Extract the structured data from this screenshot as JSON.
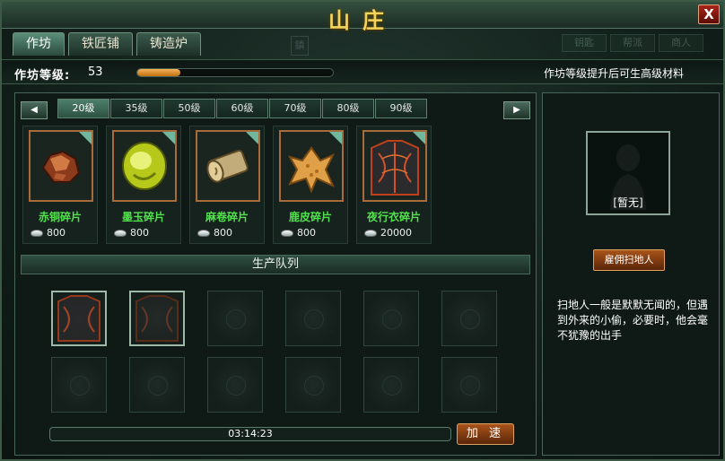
{
  "window": {
    "title": "山庄",
    "close_label": "X"
  },
  "tabs": [
    {
      "label": "作坊",
      "active": true
    },
    {
      "label": "铁匠铺",
      "active": false
    },
    {
      "label": "铸造炉",
      "active": false
    }
  ],
  "background_tabs": [
    "钥匙",
    "帮派",
    "商人"
  ],
  "workshop": {
    "level_label": "作坊等级:",
    "level_value": "53",
    "level_progress": 0.22,
    "hint": "作坊等级提升后可生高级材料"
  },
  "level_tabs": [
    {
      "label": "20级",
      "active": true
    },
    {
      "label": "35级",
      "active": false
    },
    {
      "label": "50级",
      "active": false
    },
    {
      "label": "60级",
      "active": false
    },
    {
      "label": "70级",
      "active": false
    },
    {
      "label": "80级",
      "active": false
    },
    {
      "label": "90级",
      "active": false
    }
  ],
  "items": [
    {
      "name": "赤铜碎片",
      "cost": "800",
      "icon": "copper-ore-icon"
    },
    {
      "name": "墨玉碎片",
      "cost": "800",
      "icon": "jade-icon"
    },
    {
      "name": "麻卷碎片",
      "cost": "800",
      "icon": "hemp-roll-icon"
    },
    {
      "name": "鹿皮碎片",
      "cost": "800",
      "icon": "deer-hide-icon"
    },
    {
      "name": "夜行衣碎片",
      "cost": "20000",
      "icon": "night-robe-icon"
    }
  ],
  "queue": {
    "header": "生产队列",
    "timer": "03:14:23",
    "speedup_label": "加 速",
    "slots_total": 12,
    "occupied": [
      1,
      2
    ]
  },
  "sweeper": {
    "portrait_label": "[暂无]",
    "hire_label": "雇佣扫地人",
    "description": "扫地人一般是默默无闻的，但遇到外来的小偷，必要时，他会毫不犹豫的出手"
  },
  "colors": {
    "item_name": "#51e24d",
    "progress_fill": "#e0922a",
    "button_orange": "#8a3f12",
    "title_gold": "#f4d35c"
  }
}
